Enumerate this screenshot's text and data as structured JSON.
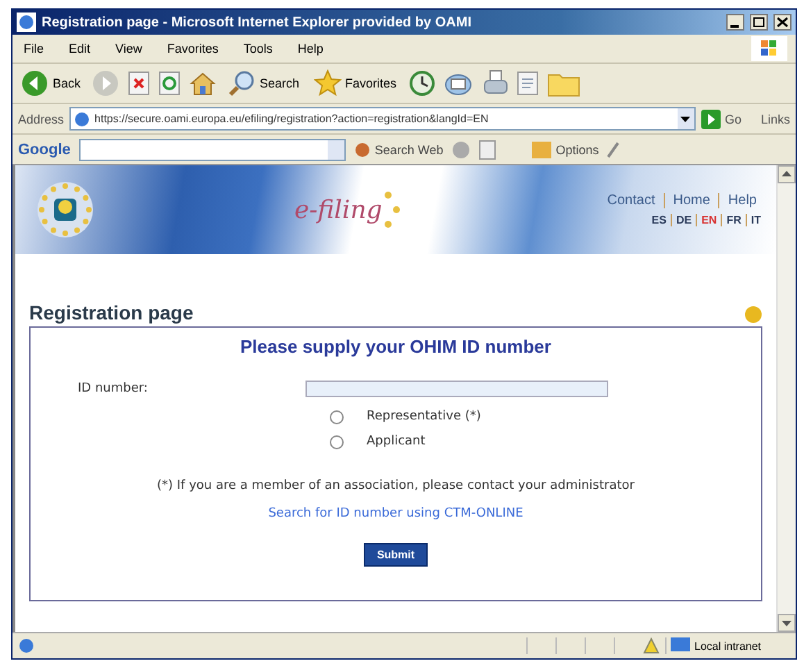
{
  "window": {
    "title": "Registration page - Microsoft Internet Explorer provided by OAMI"
  },
  "menu": [
    "File",
    "Edit",
    "View",
    "Favorites",
    "Tools",
    "Help"
  ],
  "toolbar": [
    {
      "kind": "back",
      "label": "Back"
    },
    {
      "kind": "forward"
    },
    {
      "kind": "stop"
    },
    {
      "kind": "refresh"
    },
    {
      "kind": "home"
    },
    {
      "kind": "search",
      "label": "Search"
    },
    {
      "kind": "favorites",
      "label": "Favorites"
    },
    {
      "kind": "history"
    },
    {
      "kind": "mail"
    },
    {
      "kind": "print"
    },
    {
      "kind": "edit"
    },
    {
      "kind": "folder"
    }
  ],
  "address": {
    "label": "Address",
    "value": "https://secure.oami.europa.eu/efiling/registration?action=registration&langId=EN",
    "go": "Go",
    "links": "Links"
  },
  "google_bar": {
    "logo": "Google",
    "search": "Search Web",
    "options": "Options"
  },
  "site": {
    "logo_text": "e-filing",
    "nav": [
      "Contact",
      "Home",
      "Help"
    ],
    "languages": [
      {
        "code": "ES",
        "selected": false
      },
      {
        "code": "DE",
        "selected": false
      },
      {
        "code": "EN",
        "selected": true
      },
      {
        "code": "FR",
        "selected": false
      },
      {
        "code": "IT",
        "selected": false
      }
    ]
  },
  "page": {
    "heading": "Registration page",
    "form_title": "Please supply your OHIM ID number",
    "id_label": "ID number:",
    "roles": [
      {
        "label": "Representative (*)",
        "selected": false
      },
      {
        "label": "Applicant",
        "selected": false
      }
    ],
    "note": "(*) If you are a member of an association, please contact your administrator",
    "link": "Search for ID number using CTM-ONLINE",
    "submit": "Submit"
  },
  "status_bar": {
    "zone": "Local intranet"
  }
}
